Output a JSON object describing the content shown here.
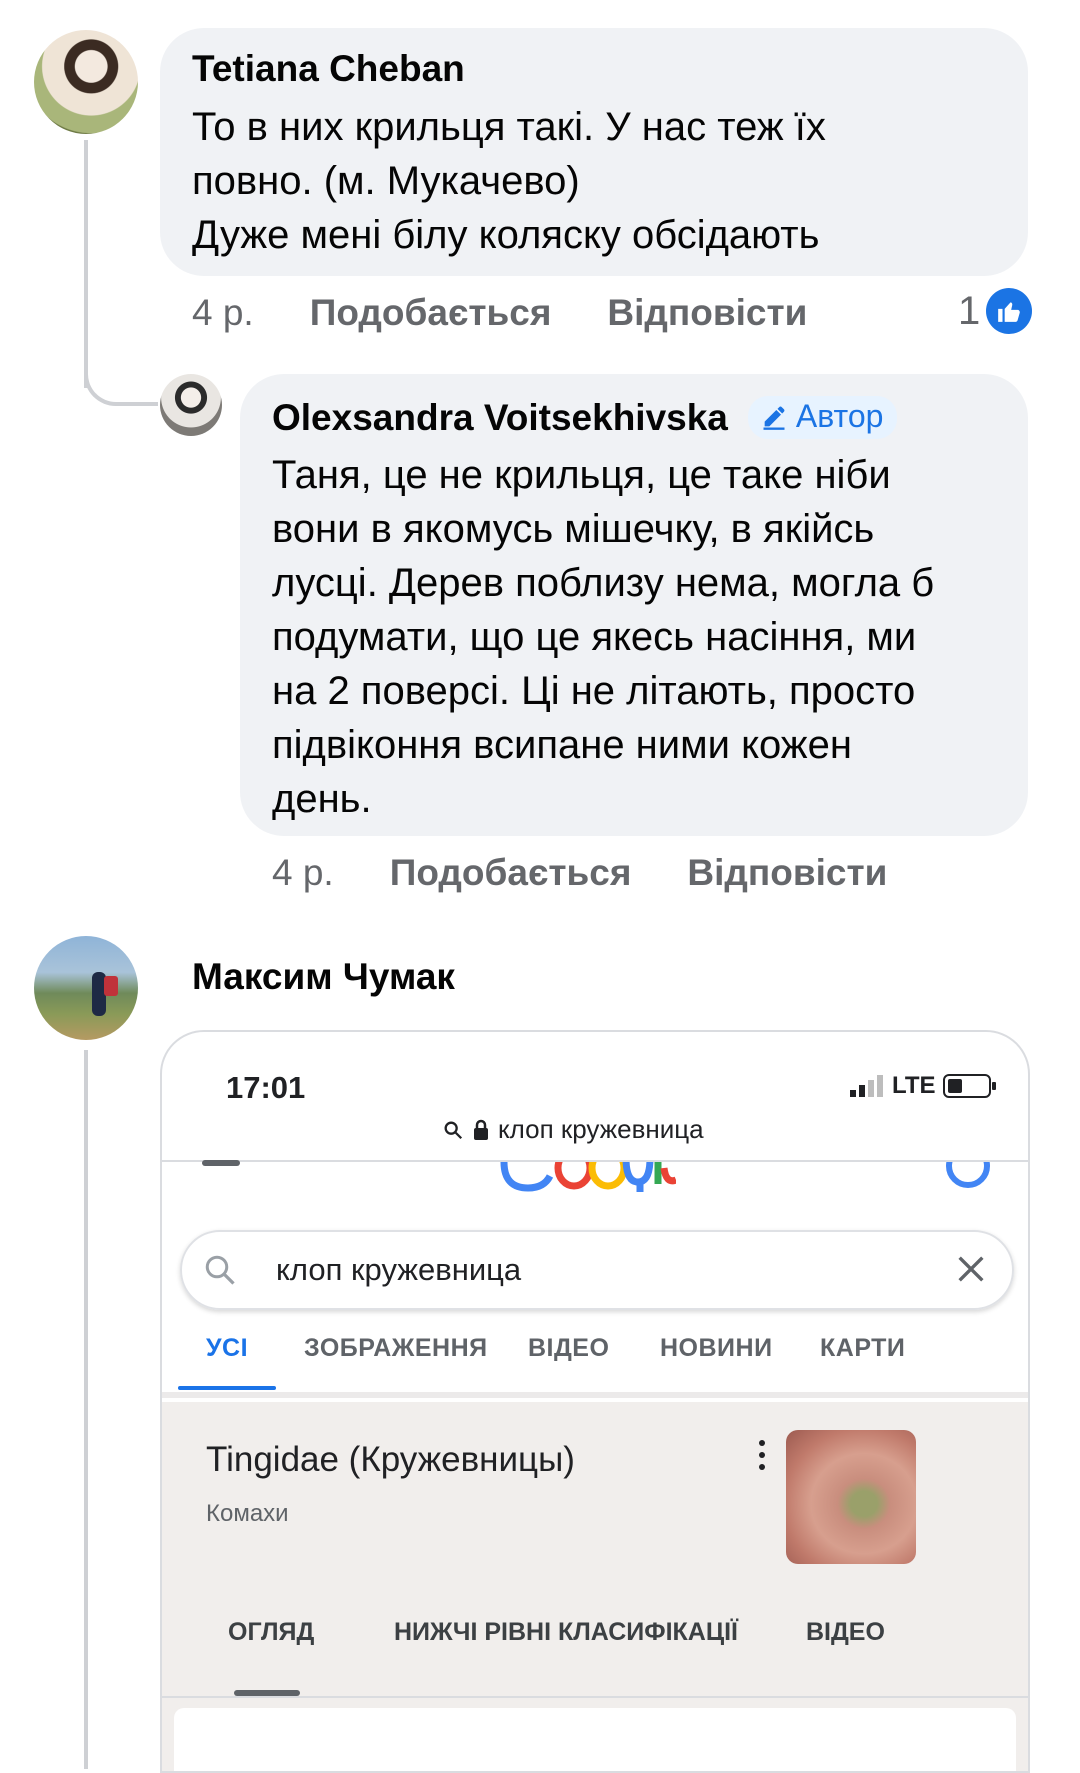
{
  "comments": [
    {
      "author": "Tetiana Cheban",
      "text": "То в них крильця такі. У нас теж їх\nповно. (м. Мукачево)\nДуже мені білу коляску обсідають",
      "time": "4 р.",
      "like": "Подобається",
      "reply": "Відповісти",
      "reactions": "1"
    },
    {
      "author": "Olexsandra Voitsekhivska",
      "badge": "Автор",
      "text": "Таня, це не крильця, це таке ніби\nвони в якомусь мішечку, в якійсь\nлусці. Дерев поблизу нема, могла б\nподумати, що це якесь насіння, ми\nна 2 поверсі. Ці не літають, просто\nпідвіконня всипане ними кожен\nдень.",
      "time": "4 р.",
      "like": "Подобається",
      "reply": "Відповісти"
    },
    {
      "author": "Максим Чумак"
    }
  ],
  "screenshot": {
    "time": "17:01",
    "network": "LTE",
    "url": "клоп кружевница",
    "search_value": "клоп кружевница",
    "tabs": [
      "УСІ",
      "ЗОБРАЖЕННЯ",
      "ВІДЕО",
      "НОВИНИ",
      "КАРТИ"
    ],
    "kp_title": "Tingidae (Кружевницы)",
    "kp_subtitle": "Комахи",
    "kp_tabs": [
      "ОГЛЯД",
      "НИЖЧІ РІВНІ КЛАСИФІКАЦІЇ",
      "ВІДЕО"
    ]
  },
  "colors": {
    "facebook_blue": "#1b74e4",
    "google_blue": "#1a73e8",
    "bubble_bg": "#f0f2f5"
  },
  "icons": [
    "pencil-icon",
    "like-icon",
    "search-icon",
    "lock-icon",
    "signal-icon",
    "battery-icon",
    "close-icon",
    "more-vert-icon"
  ]
}
